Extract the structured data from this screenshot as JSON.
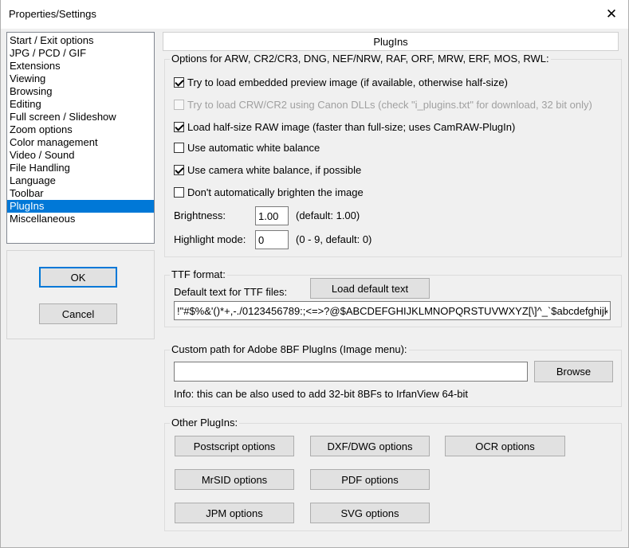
{
  "window": {
    "title": "Properties/Settings",
    "close_glyph": "✕"
  },
  "sidebar": {
    "items": [
      {
        "label": "Start / Exit options"
      },
      {
        "label": "JPG / PCD / GIF"
      },
      {
        "label": "Extensions"
      },
      {
        "label": "Viewing"
      },
      {
        "label": "Browsing"
      },
      {
        "label": "Editing"
      },
      {
        "label": "Full screen / Slideshow"
      },
      {
        "label": "Zoom options"
      },
      {
        "label": "Color management"
      },
      {
        "label": "Video / Sound"
      },
      {
        "label": "File Handling"
      },
      {
        "label": "Language"
      },
      {
        "label": "Toolbar"
      },
      {
        "label": "PlugIns",
        "selected": true
      },
      {
        "label": "Miscellaneous"
      }
    ]
  },
  "buttons": {
    "ok": "OK",
    "cancel": "Cancel"
  },
  "page": {
    "header": "PlugIns"
  },
  "raw": {
    "group_label": "Options for ARW, CR2/CR3, DNG, NEF/NRW, RAF, ORF, MRW, ERF, MOS, RWL:",
    "options": [
      {
        "label": "Try to load embedded preview image (if available, otherwise half-size)",
        "checked": true,
        "enabled": true
      },
      {
        "label": "Try to load CRW/CR2 using Canon DLLs (check \"i_plugins.txt\" for download, 32 bit only)",
        "checked": false,
        "enabled": false
      },
      {
        "label": "Load half-size RAW image (faster than full-size; uses CamRAW-PlugIn)",
        "checked": true,
        "enabled": true
      },
      {
        "label": "Use automatic white balance",
        "checked": false,
        "enabled": true
      },
      {
        "label": "Use camera white balance, if possible",
        "checked": true,
        "enabled": true
      },
      {
        "label": "Don't automatically brighten the image",
        "checked": false,
        "enabled": true
      }
    ],
    "brightness_label": "Brightness:",
    "brightness_value": "1.00",
    "brightness_hint": "(default: 1.00)",
    "highlight_label": "Highlight mode:",
    "highlight_value": "0",
    "highlight_hint": "(0 - 9, default: 0)"
  },
  "ttf": {
    "group_label": "TTF format:",
    "default_text_label": "Default text for TTF files:",
    "load_button": "Load default text",
    "text_value": "!\"#$%&'()*+,-./0123456789:;<=>?@$ABCDEFGHIJKLMNOPQRSTUVWXYZ[\\]^_`$abcdefghijk"
  },
  "custom_path": {
    "group_label": "Custom path for Adobe 8BF PlugIns (Image menu):",
    "path_value": "",
    "browse_button": "Browse",
    "info": "Info: this can be also used to add 32-bit 8BFs to IrfanView 64-bit"
  },
  "other": {
    "group_label": "Other PlugIns:",
    "postscript": "Postscript options",
    "dxf": "DXF/DWG options",
    "ocr": "OCR options",
    "mrsid": "MrSID options",
    "pdf": "PDF options",
    "jpm": "JPM options",
    "svg": "SVG options"
  }
}
